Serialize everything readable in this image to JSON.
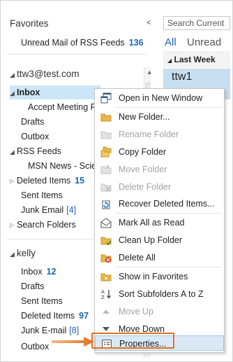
{
  "folder_pane": {
    "favorites_header": "Favorites",
    "favorites": [
      {
        "label": "Unread Mail of RSS Feeds",
        "count": "136"
      }
    ],
    "collapse_glyph": "<",
    "account1": {
      "email": "ttw3@test.com",
      "items": [
        {
          "label": "Inbox"
        },
        {
          "label": "Accept Meeting Re"
        },
        {
          "label": "Drafts"
        },
        {
          "label": "Outbox"
        },
        {
          "label": "RSS Feeds"
        },
        {
          "label": "MSN News - Scien"
        },
        {
          "label": "Deleted Items",
          "count": "15"
        },
        {
          "label": "Sent Items"
        },
        {
          "label": "Junk Email",
          "count": "[4]"
        },
        {
          "label": "Search Folders"
        }
      ]
    },
    "account2": {
      "name": "kelly",
      "items": [
        {
          "label": "Inbox",
          "count": "12"
        },
        {
          "label": "Drafts"
        },
        {
          "label": "Sent Items"
        },
        {
          "label": "Deleted Items",
          "count": "97"
        },
        {
          "label": "Junk E-mail",
          "count": "[8]"
        },
        {
          "label": "Outbox"
        }
      ]
    }
  },
  "right_pane": {
    "search_placeholder": "Search Current",
    "tabs": [
      "All",
      "Unread"
    ],
    "group_header": "Last Week",
    "mail_sender": "ttw1"
  },
  "context_menu": {
    "items": [
      {
        "label": "Open in New Window",
        "icon": "new-window-icon",
        "disabled": false
      },
      {
        "label": "New Folder...",
        "icon": "new-folder-icon",
        "disabled": false
      },
      {
        "label": "Rename Folder",
        "icon": "rename-folder-icon",
        "disabled": true
      },
      {
        "label": "Copy Folder",
        "icon": "copy-folder-icon",
        "disabled": false
      },
      {
        "label": "Move Folder",
        "icon": "move-folder-icon",
        "disabled": true
      },
      {
        "label": "Delete Folder",
        "icon": "delete-folder-icon",
        "disabled": true
      },
      {
        "label": "Recover Deleted Items...",
        "icon": "recover-icon",
        "disabled": false
      },
      {
        "label": "Mark All as Read",
        "icon": "mark-read-icon",
        "disabled": false
      },
      {
        "label": "Clean Up Folder",
        "icon": "cleanup-icon",
        "disabled": false
      },
      {
        "label": "Delete All",
        "icon": "delete-all-icon",
        "disabled": false
      },
      {
        "label": "Show in Favorites",
        "icon": "favorites-icon",
        "disabled": false
      },
      {
        "label": "Sort Subfolders A to Z",
        "icon": "sort-az-icon",
        "disabled": false
      },
      {
        "label": "Move Up",
        "icon": "move-up-icon",
        "disabled": true
      },
      {
        "label": "Move Down",
        "icon": "move-down-icon",
        "disabled": false
      },
      {
        "label": "Properties...",
        "icon": "properties-icon",
        "disabled": false
      }
    ]
  },
  "colors": {
    "accent": "#1a66b3",
    "selection": "#cde6f7",
    "highlight": "#e36f1e"
  }
}
